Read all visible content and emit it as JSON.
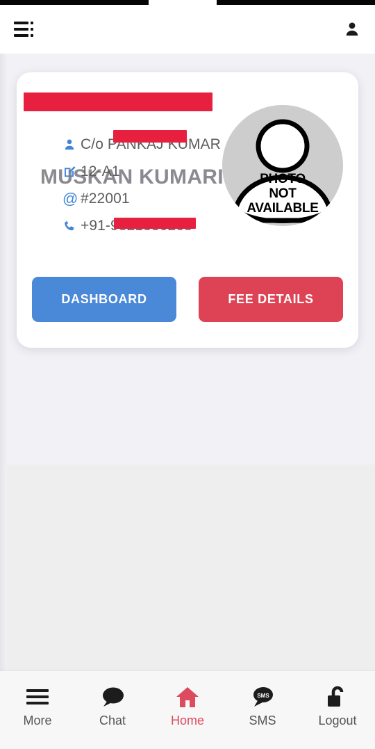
{
  "header": {
    "menu_icon": "hamburger-menu-icon",
    "account_icon": "account-person-icon"
  },
  "card": {
    "student_name": "MUSKAN KUMARI",
    "details": [
      {
        "icon": "person-icon",
        "value": "C/o PANKAJ KUMAR"
      },
      {
        "icon": "edit-square-icon",
        "value": "12-A1"
      },
      {
        "icon": "at-sign-icon",
        "value": "#22001"
      },
      {
        "icon": "phone-icon",
        "value": "+91-9821330268"
      }
    ],
    "photo": {
      "icon": "photo-not-available-avatar",
      "line1": "PHOTO",
      "line2": "NOT",
      "line3": "AVAILABLE"
    },
    "buttons": {
      "dashboard_label": "DASHBOARD",
      "fee_details_label": "FEE DETAILS"
    }
  },
  "bottom_nav": {
    "items": [
      {
        "label": "More",
        "icon": "hamburger-menu-icon",
        "active": false
      },
      {
        "label": "Chat",
        "icon": "chat-bubble-icon",
        "active": false
      },
      {
        "label": "Home",
        "icon": "home-house-icon",
        "active": true
      },
      {
        "label": "SMS",
        "icon": "sms-bubble-icon",
        "active": false
      },
      {
        "label": "Logout",
        "icon": "open-padlock-icon",
        "active": false
      }
    ]
  },
  "colors": {
    "primary_blue": "#4a88d8",
    "accent_red": "#dd4355",
    "active_nav_red": "#dd4b5e",
    "redaction_red": "#e8203f",
    "icon_blue": "#4285d4",
    "page_bg_upper": "#f2f1f6",
    "page_bg_lower": "#eeeeee",
    "card_bg": "#ffffff",
    "nav_bg": "#f7f7f7",
    "detail_text": "#5d5d5d"
  }
}
